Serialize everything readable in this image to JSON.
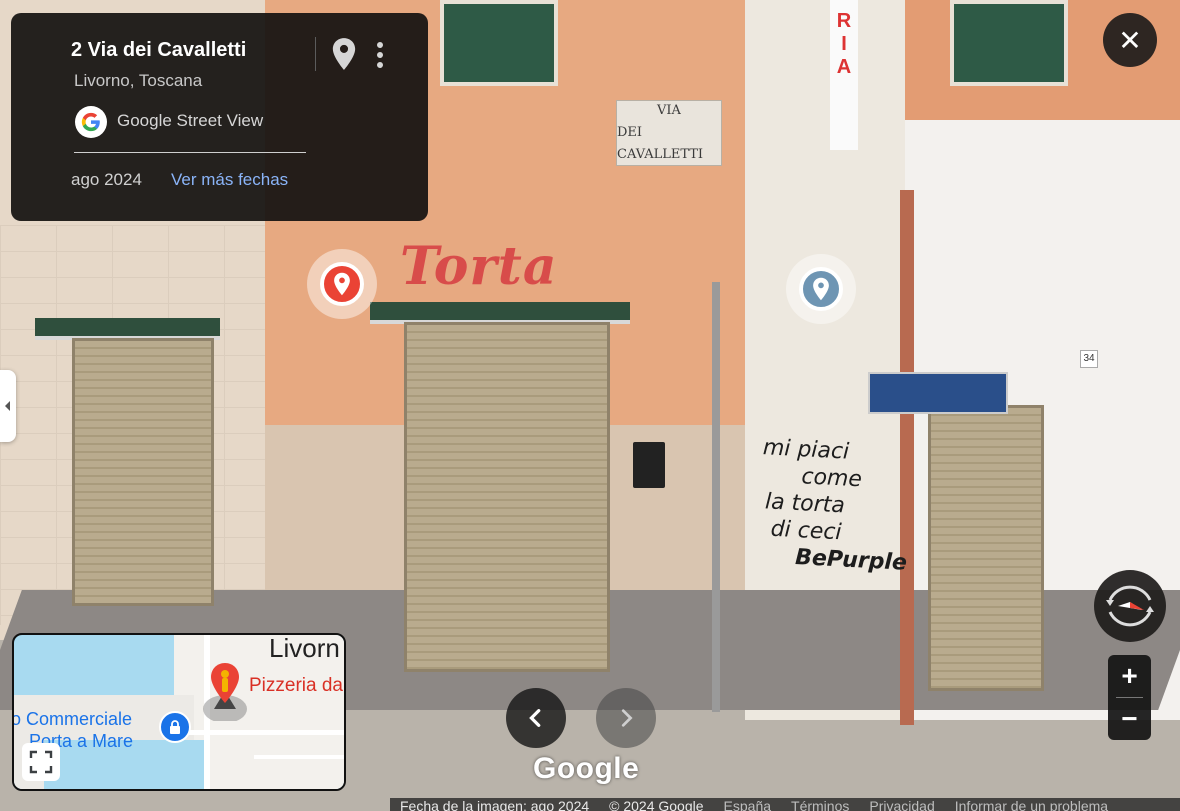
{
  "info_card": {
    "title": "2 Via dei Cavalletti",
    "subtitle": "Livorno, Toscana",
    "source_label": "Google Street View",
    "date": "ago 2024",
    "more_dates_link": "Ver más fechas"
  },
  "scene": {
    "shop_sign": "Torta",
    "street_plate": [
      "VIA",
      "DEI CAVALLETTI"
    ],
    "vertical_sign": [
      "R",
      "I",
      "A"
    ],
    "graffiti": [
      "mi piaci",
      "come",
      "la torta",
      "di ceci",
      "BePurple"
    ],
    "house_number": "34"
  },
  "minimap": {
    "city_label": "Livorn",
    "poi_label": "Pizzeria da",
    "mall_label_line1": "o Commerciale",
    "mall_label_line2": "Porta a Mare"
  },
  "branding": {
    "wordmark": "Google"
  },
  "controls": {
    "close_glyph": "✕",
    "zoom_in_glyph": "+",
    "zoom_out_glyph": "−",
    "prev_glyph": "‹",
    "next_glyph": "›"
  },
  "footer": {
    "image_date": "Fecha de la imagen: ago 2024",
    "copyright": "© 2024 Google",
    "country": "España",
    "terms": "Términos",
    "privacy": "Privacidad",
    "report": "Informar de un problema"
  },
  "icons": {
    "card_pin": "map-pin-icon",
    "card_more": "more-vert-icon",
    "marker_red": "place-pin-icon",
    "marker_blue": "place-pin-icon",
    "compass": "compass-icon",
    "expand": "fullscreen-icon",
    "lock": "lock-icon"
  },
  "colors": {
    "card_bg": "#141211",
    "link": "#8ab4f8",
    "marker_red": "#ea4335",
    "marker_blue": "#6e95b3",
    "map_water": "#a8daf0",
    "poi_red": "#d93025",
    "mall_blue": "#1a73e8"
  }
}
